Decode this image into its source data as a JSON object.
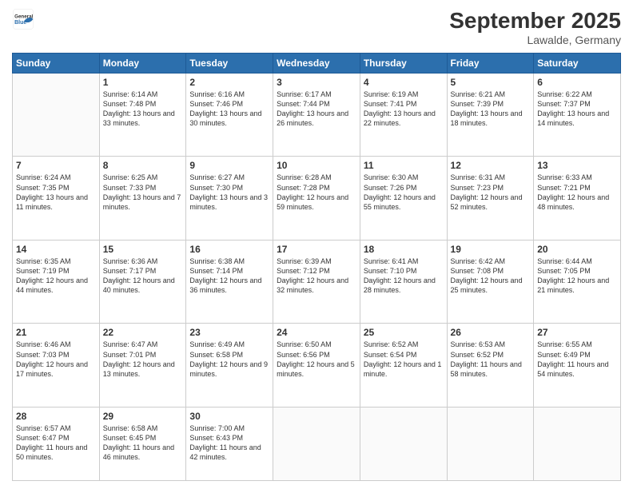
{
  "header": {
    "logo_general": "General",
    "logo_blue": "Blue",
    "month_year": "September 2025",
    "location": "Lawalde, Germany"
  },
  "weekdays": [
    "Sunday",
    "Monday",
    "Tuesday",
    "Wednesday",
    "Thursday",
    "Friday",
    "Saturday"
  ],
  "weeks": [
    [
      {
        "day": null,
        "sunrise": null,
        "sunset": null,
        "daylight": null
      },
      {
        "day": 1,
        "sunrise": "Sunrise: 6:14 AM",
        "sunset": "Sunset: 7:48 PM",
        "daylight": "Daylight: 13 hours and 33 minutes."
      },
      {
        "day": 2,
        "sunrise": "Sunrise: 6:16 AM",
        "sunset": "Sunset: 7:46 PM",
        "daylight": "Daylight: 13 hours and 30 minutes."
      },
      {
        "day": 3,
        "sunrise": "Sunrise: 6:17 AM",
        "sunset": "Sunset: 7:44 PM",
        "daylight": "Daylight: 13 hours and 26 minutes."
      },
      {
        "day": 4,
        "sunrise": "Sunrise: 6:19 AM",
        "sunset": "Sunset: 7:41 PM",
        "daylight": "Daylight: 13 hours and 22 minutes."
      },
      {
        "day": 5,
        "sunrise": "Sunrise: 6:21 AM",
        "sunset": "Sunset: 7:39 PM",
        "daylight": "Daylight: 13 hours and 18 minutes."
      },
      {
        "day": 6,
        "sunrise": "Sunrise: 6:22 AM",
        "sunset": "Sunset: 7:37 PM",
        "daylight": "Daylight: 13 hours and 14 minutes."
      }
    ],
    [
      {
        "day": 7,
        "sunrise": "Sunrise: 6:24 AM",
        "sunset": "Sunset: 7:35 PM",
        "daylight": "Daylight: 13 hours and 11 minutes."
      },
      {
        "day": 8,
        "sunrise": "Sunrise: 6:25 AM",
        "sunset": "Sunset: 7:33 PM",
        "daylight": "Daylight: 13 hours and 7 minutes."
      },
      {
        "day": 9,
        "sunrise": "Sunrise: 6:27 AM",
        "sunset": "Sunset: 7:30 PM",
        "daylight": "Daylight: 13 hours and 3 minutes."
      },
      {
        "day": 10,
        "sunrise": "Sunrise: 6:28 AM",
        "sunset": "Sunset: 7:28 PM",
        "daylight": "Daylight: 12 hours and 59 minutes."
      },
      {
        "day": 11,
        "sunrise": "Sunrise: 6:30 AM",
        "sunset": "Sunset: 7:26 PM",
        "daylight": "Daylight: 12 hours and 55 minutes."
      },
      {
        "day": 12,
        "sunrise": "Sunrise: 6:31 AM",
        "sunset": "Sunset: 7:23 PM",
        "daylight": "Daylight: 12 hours and 52 minutes."
      },
      {
        "day": 13,
        "sunrise": "Sunrise: 6:33 AM",
        "sunset": "Sunset: 7:21 PM",
        "daylight": "Daylight: 12 hours and 48 minutes."
      }
    ],
    [
      {
        "day": 14,
        "sunrise": "Sunrise: 6:35 AM",
        "sunset": "Sunset: 7:19 PM",
        "daylight": "Daylight: 12 hours and 44 minutes."
      },
      {
        "day": 15,
        "sunrise": "Sunrise: 6:36 AM",
        "sunset": "Sunset: 7:17 PM",
        "daylight": "Daylight: 12 hours and 40 minutes."
      },
      {
        "day": 16,
        "sunrise": "Sunrise: 6:38 AM",
        "sunset": "Sunset: 7:14 PM",
        "daylight": "Daylight: 12 hours and 36 minutes."
      },
      {
        "day": 17,
        "sunrise": "Sunrise: 6:39 AM",
        "sunset": "Sunset: 7:12 PM",
        "daylight": "Daylight: 12 hours and 32 minutes."
      },
      {
        "day": 18,
        "sunrise": "Sunrise: 6:41 AM",
        "sunset": "Sunset: 7:10 PM",
        "daylight": "Daylight: 12 hours and 28 minutes."
      },
      {
        "day": 19,
        "sunrise": "Sunrise: 6:42 AM",
        "sunset": "Sunset: 7:08 PM",
        "daylight": "Daylight: 12 hours and 25 minutes."
      },
      {
        "day": 20,
        "sunrise": "Sunrise: 6:44 AM",
        "sunset": "Sunset: 7:05 PM",
        "daylight": "Daylight: 12 hours and 21 minutes."
      }
    ],
    [
      {
        "day": 21,
        "sunrise": "Sunrise: 6:46 AM",
        "sunset": "Sunset: 7:03 PM",
        "daylight": "Daylight: 12 hours and 17 minutes."
      },
      {
        "day": 22,
        "sunrise": "Sunrise: 6:47 AM",
        "sunset": "Sunset: 7:01 PM",
        "daylight": "Daylight: 12 hours and 13 minutes."
      },
      {
        "day": 23,
        "sunrise": "Sunrise: 6:49 AM",
        "sunset": "Sunset: 6:58 PM",
        "daylight": "Daylight: 12 hours and 9 minutes."
      },
      {
        "day": 24,
        "sunrise": "Sunrise: 6:50 AM",
        "sunset": "Sunset: 6:56 PM",
        "daylight": "Daylight: 12 hours and 5 minutes."
      },
      {
        "day": 25,
        "sunrise": "Sunrise: 6:52 AM",
        "sunset": "Sunset: 6:54 PM",
        "daylight": "Daylight: 12 hours and 1 minute."
      },
      {
        "day": 26,
        "sunrise": "Sunrise: 6:53 AM",
        "sunset": "Sunset: 6:52 PM",
        "daylight": "Daylight: 11 hours and 58 minutes."
      },
      {
        "day": 27,
        "sunrise": "Sunrise: 6:55 AM",
        "sunset": "Sunset: 6:49 PM",
        "daylight": "Daylight: 11 hours and 54 minutes."
      }
    ],
    [
      {
        "day": 28,
        "sunrise": "Sunrise: 6:57 AM",
        "sunset": "Sunset: 6:47 PM",
        "daylight": "Daylight: 11 hours and 50 minutes."
      },
      {
        "day": 29,
        "sunrise": "Sunrise: 6:58 AM",
        "sunset": "Sunset: 6:45 PM",
        "daylight": "Daylight: 11 hours and 46 minutes."
      },
      {
        "day": 30,
        "sunrise": "Sunrise: 7:00 AM",
        "sunset": "Sunset: 6:43 PM",
        "daylight": "Daylight: 11 hours and 42 minutes."
      },
      {
        "day": null,
        "sunrise": null,
        "sunset": null,
        "daylight": null
      },
      {
        "day": null,
        "sunrise": null,
        "sunset": null,
        "daylight": null
      },
      {
        "day": null,
        "sunrise": null,
        "sunset": null,
        "daylight": null
      },
      {
        "day": null,
        "sunrise": null,
        "sunset": null,
        "daylight": null
      }
    ]
  ]
}
